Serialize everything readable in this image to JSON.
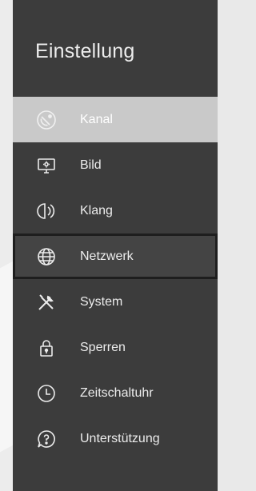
{
  "panel": {
    "title": "Einstellung"
  },
  "menu": {
    "items": [
      {
        "label": "Kanal",
        "icon": "satellite-dish-icon",
        "state": "selected"
      },
      {
        "label": "Bild",
        "icon": "monitor-icon",
        "state": "normal"
      },
      {
        "label": "Klang",
        "icon": "speaker-icon",
        "state": "normal"
      },
      {
        "label": "Netzwerk",
        "icon": "globe-icon",
        "state": "focused"
      },
      {
        "label": "System",
        "icon": "tools-icon",
        "state": "normal"
      },
      {
        "label": "Sperren",
        "icon": "lock-icon",
        "state": "normal"
      },
      {
        "label": "Zeitschaltuhr",
        "icon": "clock-icon",
        "state": "normal"
      },
      {
        "label": "Unterstützung",
        "icon": "help-bubble-icon",
        "state": "normal"
      }
    ]
  },
  "colors": {
    "panel_background": "#3c3c3c",
    "selected_background": "#c9c9c9",
    "focus_border": "#1e1e1e",
    "text": "#ececec"
  }
}
